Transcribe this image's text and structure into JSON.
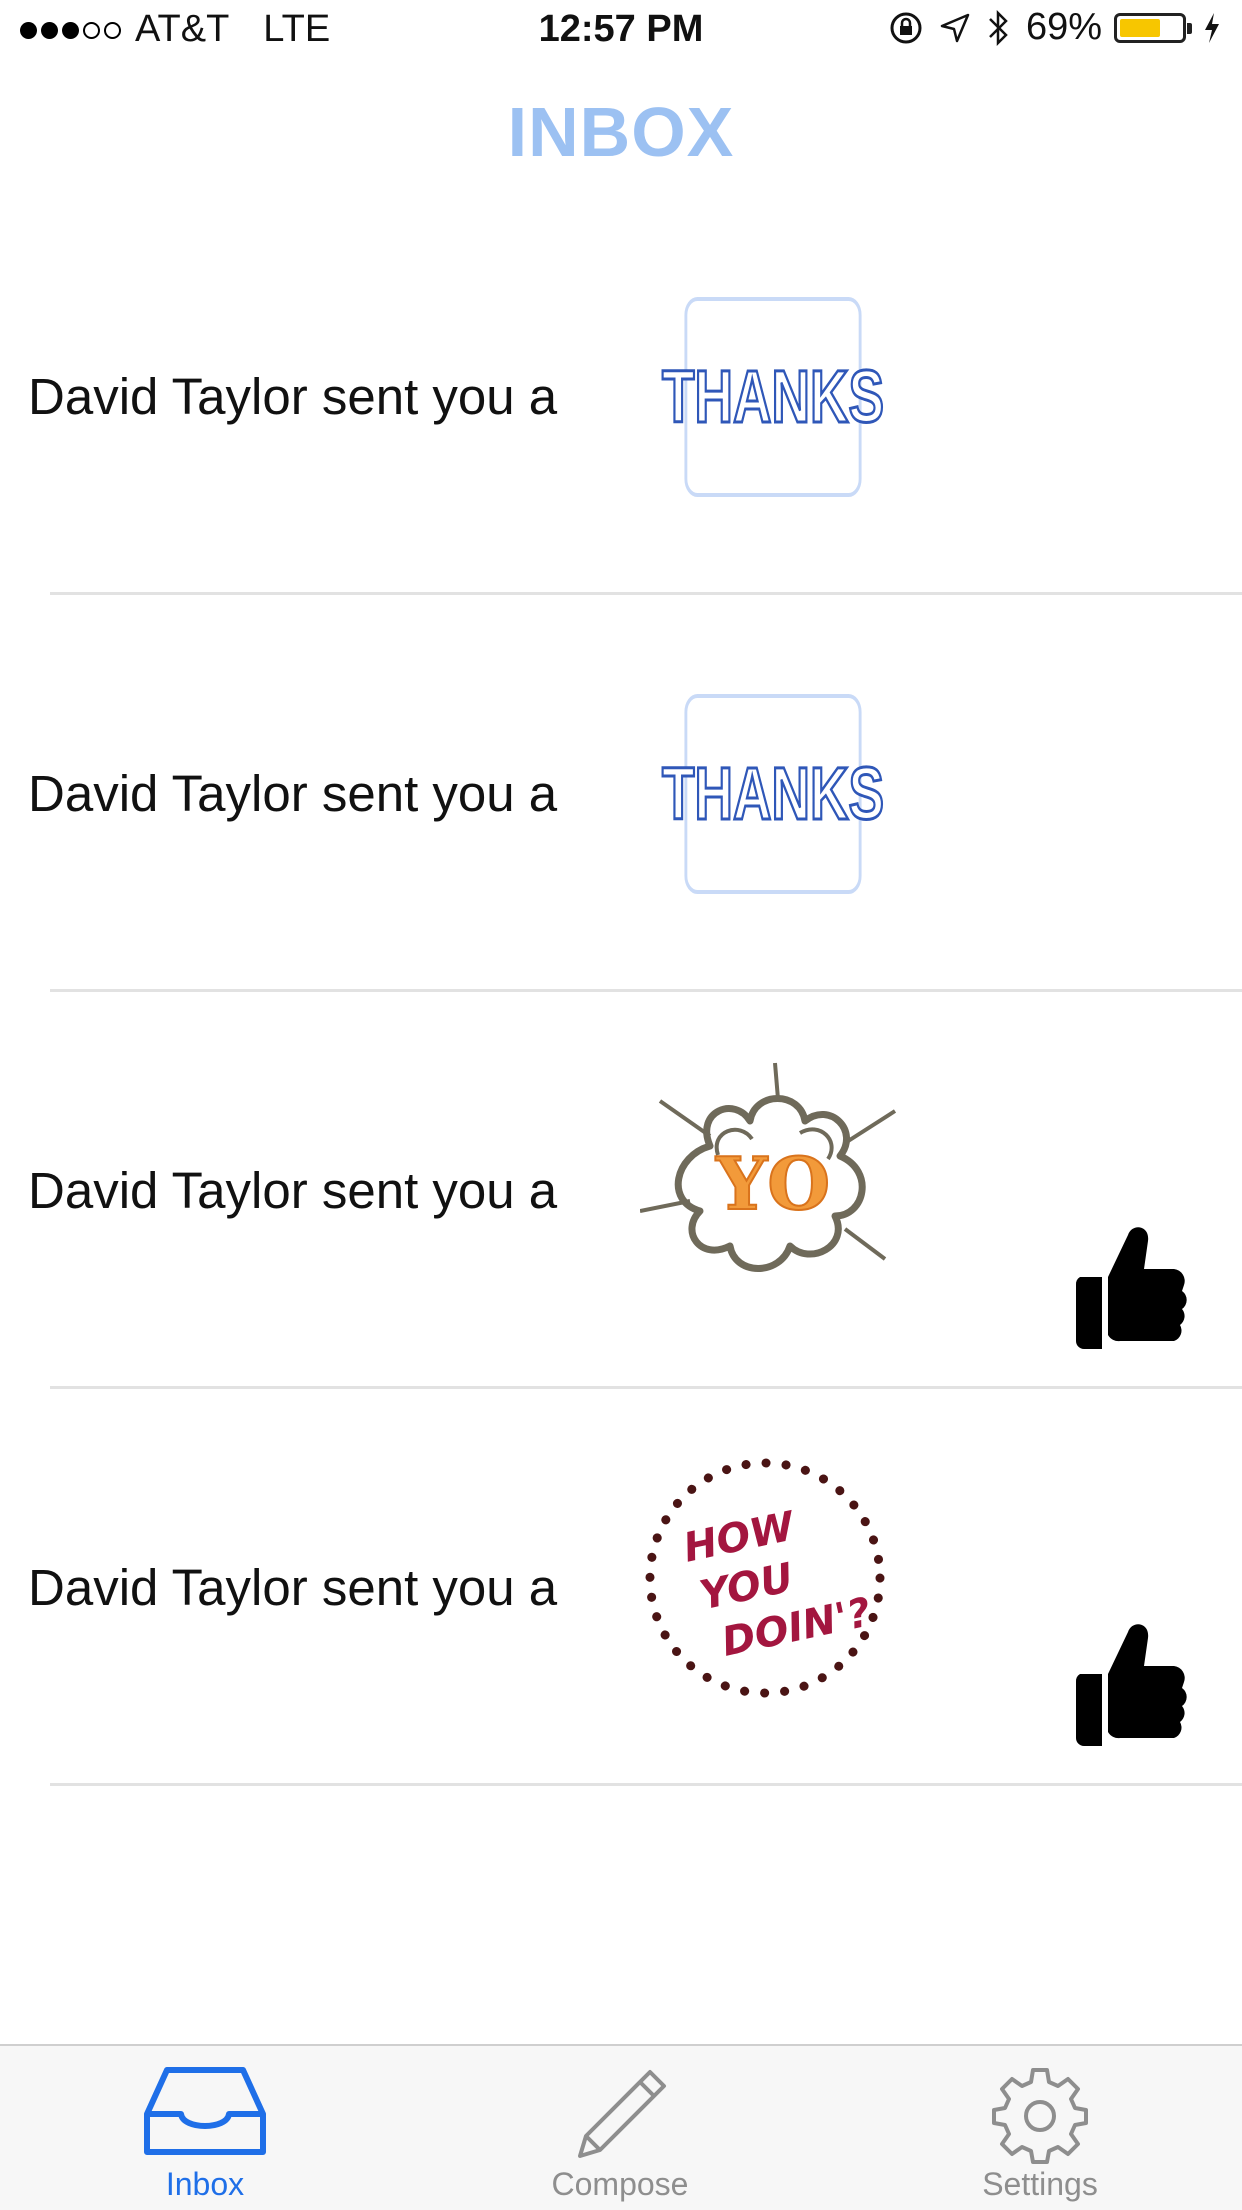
{
  "status_bar": {
    "carrier": "AT&T",
    "network": "LTE",
    "time": "12:57 PM",
    "battery": "69%",
    "battery_level": 0.69
  },
  "header": {
    "title": "INBOX"
  },
  "messages": [
    {
      "text": "David Taylor sent you a",
      "sticker": "THANKS",
      "liked": false
    },
    {
      "text": "David Taylor sent you a",
      "sticker": "THANKS",
      "liked": false
    },
    {
      "text": "David Taylor sent you a",
      "sticker": "YO",
      "liked": true
    },
    {
      "text": "David Taylor sent you a",
      "sticker_lines": [
        "HOW",
        "YOU",
        "DOIN'?"
      ],
      "liked": true
    }
  ],
  "tab_bar": {
    "tabs": [
      {
        "label": "Inbox",
        "icon": "inbox-tray-icon",
        "active": true
      },
      {
        "label": "Compose",
        "icon": "pencil-icon",
        "active": false
      },
      {
        "label": "Settings",
        "icon": "gear-icon",
        "active": false
      }
    ]
  },
  "colors": {
    "title": "#9cc1f2",
    "active_tab": "#1f6fe8",
    "inactive_tab": "#8e8e8e",
    "thanks_stroke": "#2f57b8",
    "yo_fill": "#f29a3a",
    "doin_text": "#a3163f"
  }
}
